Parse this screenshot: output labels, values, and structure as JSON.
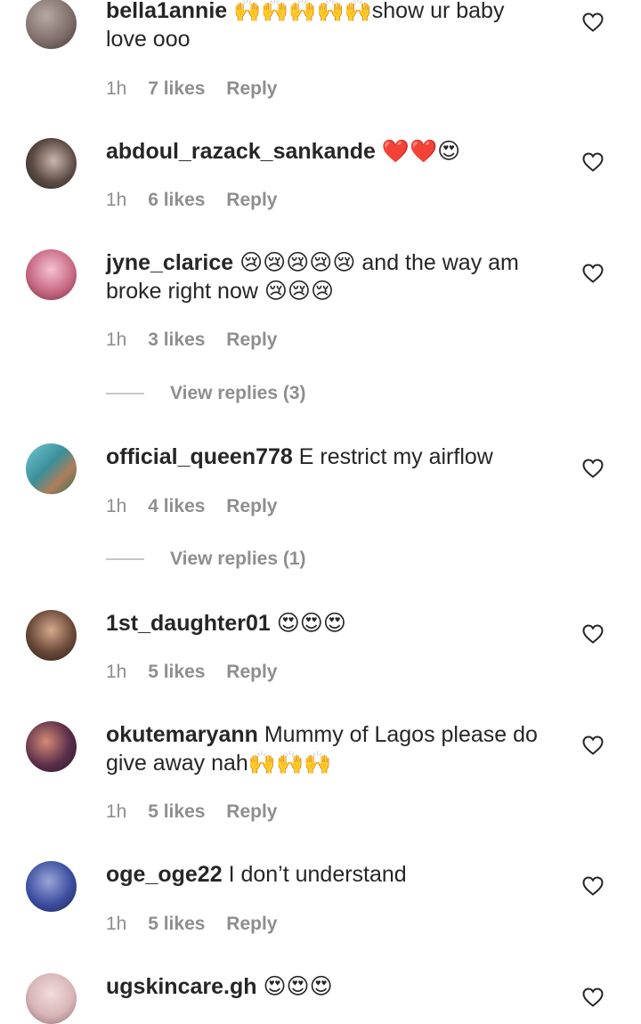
{
  "comments": [
    {
      "username": "bella1annie",
      "text": "🙌🙌🙌🙌🙌show ur baby love ooo",
      "time": "1h",
      "likes": "7 likes",
      "reply": "Reply",
      "avatar_color": "#7b6a66"
    },
    {
      "username": "abdoul_razack_sankande",
      "text": "❤️❤️😍",
      "time": "1h",
      "likes": "6 likes",
      "reply": "Reply",
      "avatar_color": "#5a4a43"
    },
    {
      "username": "jyne_clarice",
      "text": "😢😢😢😢😢 and the way am broke right now 😢😢😢",
      "time": "1h",
      "likes": "3 likes",
      "reply": "Reply",
      "avatar_color": "#c96b86",
      "view_replies": "View replies (3)"
    },
    {
      "username": "official_queen778",
      "text": "E restrict my airflow",
      "time": "1h",
      "likes": "4 likes",
      "reply": "Reply",
      "avatar_color": "#3c8f9a",
      "view_replies": "View replies (1)"
    },
    {
      "username": "1st_daughter01",
      "text": "😍😍😍",
      "time": "1h",
      "likes": "5 likes",
      "reply": "Reply",
      "avatar_color": "#6b4a3a"
    },
    {
      "username": "okutemaryann",
      "text": "Mummy of Lagos please do give away nah🙌🙌🙌",
      "time": "1h",
      "likes": "5 likes",
      "reply": "Reply",
      "avatar_color": "#5b2f4a"
    },
    {
      "username": "oge_oge22",
      "text": "I don’t understand",
      "time": "1h",
      "likes": "5 likes",
      "reply": "Reply",
      "avatar_color": "#3d4fa0"
    },
    {
      "username": "ugskincare.gh",
      "text": "😍😍😍",
      "avatar_color": "#d9b6b8"
    }
  ]
}
